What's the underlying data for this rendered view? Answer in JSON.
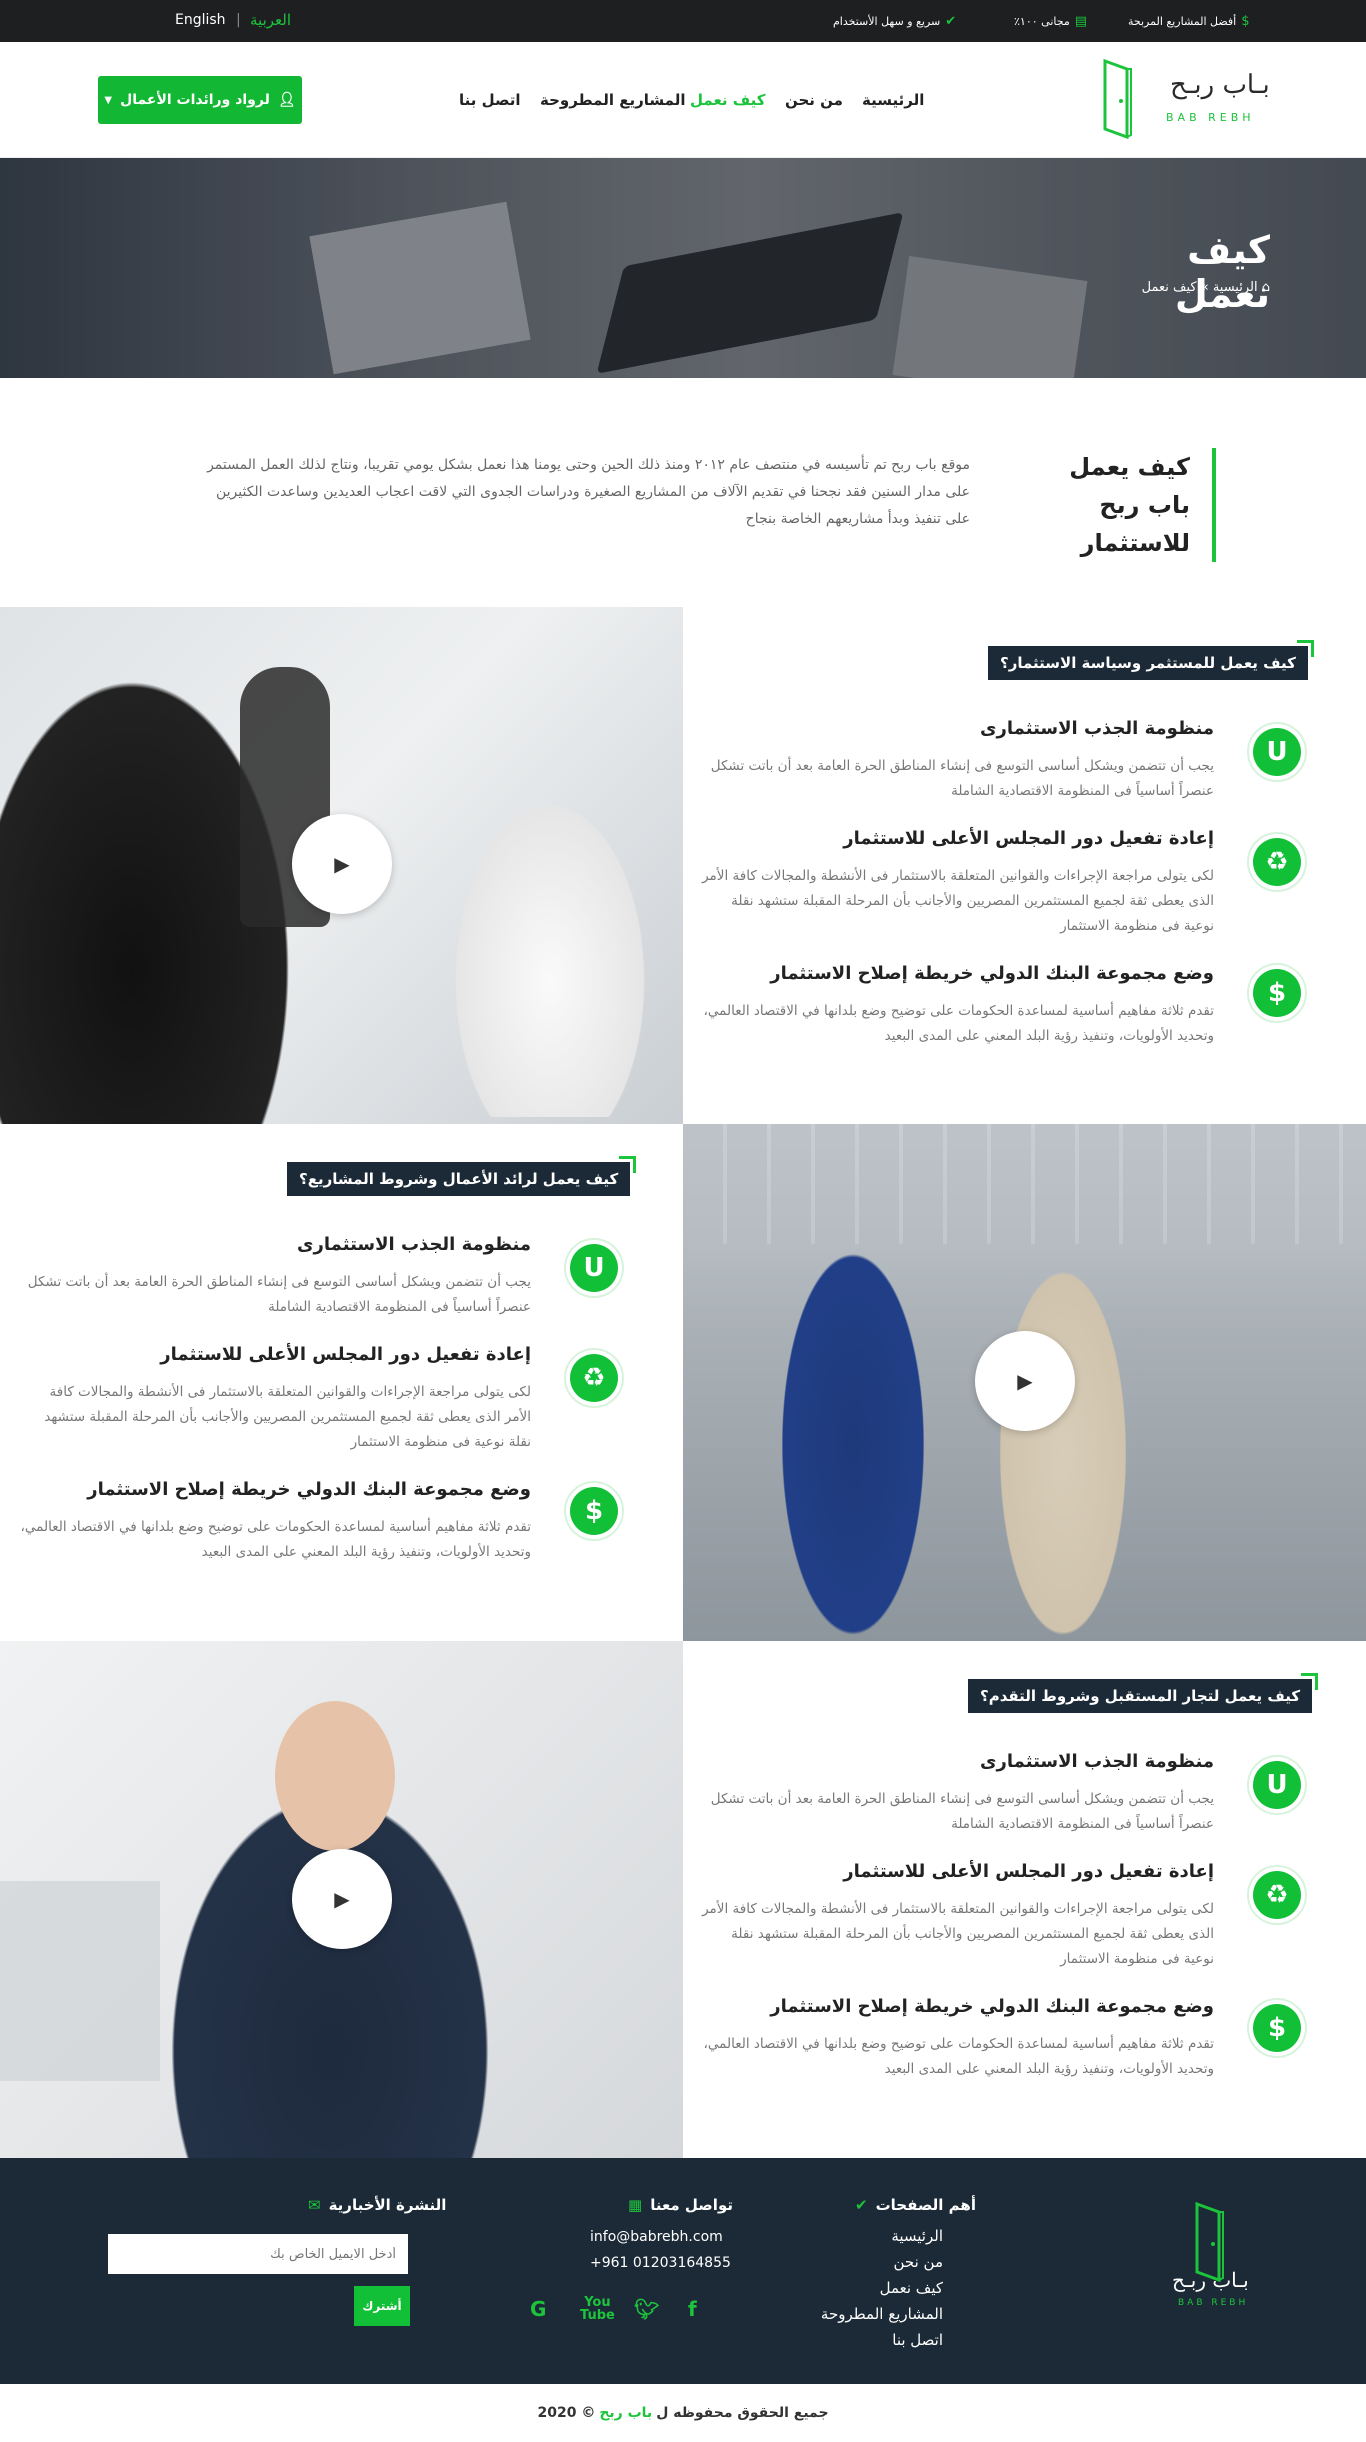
{
  "topbar": {
    "lang_en": "English",
    "lang_sep": "|",
    "lang_ar": "العربية",
    "features": [
      {
        "icon": "dollar-icon",
        "label": "أفضل المشاريع المربحة"
      },
      {
        "icon": "money-icon",
        "label": "مجانى ١٠٠٪"
      },
      {
        "icon": "check-circle-icon",
        "label": "سريع و سهل الأستخدام"
      }
    ]
  },
  "header": {
    "logo_ar": "بـاب ربـح",
    "logo_en": "BAB REBH",
    "nav": [
      "الرئيسية",
      "من نحن",
      "كيف نعمل",
      "المشاريع المطروحة",
      "اتصل بنا"
    ],
    "active_nav": "كيف نعمل",
    "cta_label": "لرواد ورائدات الأعمال"
  },
  "banner": {
    "title": "كيف نعمل",
    "crumb_home": "الرئيسية",
    "crumb_sep": "»",
    "crumb_current": "كيف نعمل"
  },
  "intro": {
    "heading_line1": "كيف يعمل",
    "heading_line2": "باب ربح للاستثمار",
    "text": "موقع باب ربح تم تأسيسه في منتصف عام ٢٠١٢ ومنذ ذلك الحين وحتى يومنا هذا نعمل بشكل يومي تقريبا، ونتاج لذلك العمل المستمر على مدار السنين فقد نجحنا في تقديم الآلاف من المشاريع الصغيرة ودراسات الجدوى التي لاقت اعجاب العديدين وساعدت الكثيرين على تنفيذ وبدأ مشاريعهم الخاصة بنجاح"
  },
  "sections": [
    {
      "badge": "كيف يعمل للمستثمر وسياسة الاستثمار؟",
      "features": [
        {
          "icon": "magnet-icon",
          "title": "منظومة الجذب الاستثمارى",
          "text": "يجب أن تتضمن ويشكل أساسى التوسع فى إنشاء المناطق الحرة العامة بعد أن باتت تشكل عنصراً أساسياً فى المنظومة الاقتصادية الشاملة"
        },
        {
          "icon": "recycle-icon",
          "title": "إعادة تفعيل دور المجلس الأعلى للاستثمار",
          "text": "لكى يتولى مراجعة الإجراءات والقوانين المتعلقة بالاستثمار فى الأنشطة والمجالات كافة الأمر الذى يعطى ثقة لجميع المستثمرين المصريين والأجانب بأن المرحلة المقبلة ستشهد نقلة نوعية فى منظومة الاستثمار"
        },
        {
          "icon": "dollar-icon",
          "title": "وضع مجموعة البنك الدولي خريطة إصلاح الاستثمار",
          "text": "تقدم ثلاثة مفاهيم أساسية لمساعدة الحكومات على توضيح وضع بلدانها في الاقتصاد العالمي، وتحديد الأولويات، وتنفيذ رؤية البلد المعني على المدى البعيد"
        }
      ]
    },
    {
      "badge": "كيف يعمل لرائد الأعمال وشروط المشاريع؟",
      "features": [
        {
          "icon": "magnet-icon",
          "title": "منظومة الجذب الاستثمارى",
          "text": "يجب أن تتضمن ويشكل أساسى التوسع فى إنشاء المناطق الحرة العامة بعد أن باتت تشكل عنصراً أساسياً فى المنظومة الاقتصادية الشاملة"
        },
        {
          "icon": "recycle-icon",
          "title": "إعادة تفعيل دور المجلس الأعلى للاستثمار",
          "text": "لكى يتولى مراجعة الإجراءات والقوانين المتعلقة بالاستثمار فى الأنشطة والمجالات كافة الأمر الذى يعطى ثقة لجميع المستثمرين المصريين والأجانب بأن المرحلة المقبلة ستشهد نقلة نوعية فى منظومة الاستثمار"
        },
        {
          "icon": "dollar-icon",
          "title": "وضع مجموعة البنك الدولي خريطة إصلاح الاستثمار",
          "text": "تقدم ثلاثة مفاهيم أساسية لمساعدة الحكومات على توضيح وضع بلدانها في الاقتصاد العالمي، وتحديد الأولويات، وتنفيذ رؤية البلد المعني على المدى البعيد"
        }
      ]
    },
    {
      "badge": "كيف يعمل لتجار المستقبل وشروط التقدم؟",
      "features": [
        {
          "icon": "magnet-icon",
          "title": "منظومة الجذب الاستثمارى",
          "text": "يجب أن تتضمن ويشكل أساسى التوسع فى إنشاء المناطق الحرة العامة بعد أن باتت تشكل عنصراً أساسياً فى المنظومة الاقتصادية الشاملة"
        },
        {
          "icon": "recycle-icon",
          "title": "إعادة تفعيل دور المجلس الأعلى للاستثمار",
          "text": "لكى يتولى مراجعة الإجراءات والقوانين المتعلقة بالاستثمار فى الأنشطة والمجالات كافة الأمر الذى يعطى ثقة لجميع المستثمرين المصريين والأجانب بأن المرحلة المقبلة ستشهد نقلة نوعية فى منظومة الاستثمار"
        },
        {
          "icon": "dollar-icon",
          "title": "وضع مجموعة البنك الدولي خريطة إصلاح الاستثمار",
          "text": "تقدم ثلاثة مفاهيم أساسية لمساعدة الحكومات على توضيح وضع بلدانها في الاقتصاد العالمي، وتحديد الأولويات، وتنفيذ رؤية البلد المعني على المدى البعيد"
        }
      ]
    }
  ],
  "footer": {
    "logo_ar": "بـاب ربـح",
    "logo_en": "BAB REBH",
    "pages_heading": "أهم الصفحات",
    "pages": [
      "الرئيسية",
      "من نحن",
      "كيف نعمل",
      "المشاريع المطروحة",
      "اتصل بنا"
    ],
    "contact_heading": "تواصل معنا",
    "email": "info@babrebh.com",
    "phone": "+961 01203164855",
    "newsletter_heading": "النشرة الأخبارية",
    "newsletter_placeholder": "أدخل الايميل الخاص بك",
    "subscribe_label": "أشترك",
    "social": [
      "facebook-icon",
      "twitter-icon",
      "youtube-icon",
      "google-icon"
    ]
  },
  "copyright": {
    "prefix": "جميع الحقوق محفوظه ل",
    "brand": "باب ربح",
    "suffix": "© 2020"
  },
  "colors": {
    "accent": "#1cc43c",
    "dark": "#1b2a36",
    "topbar": "#1d1f21"
  }
}
